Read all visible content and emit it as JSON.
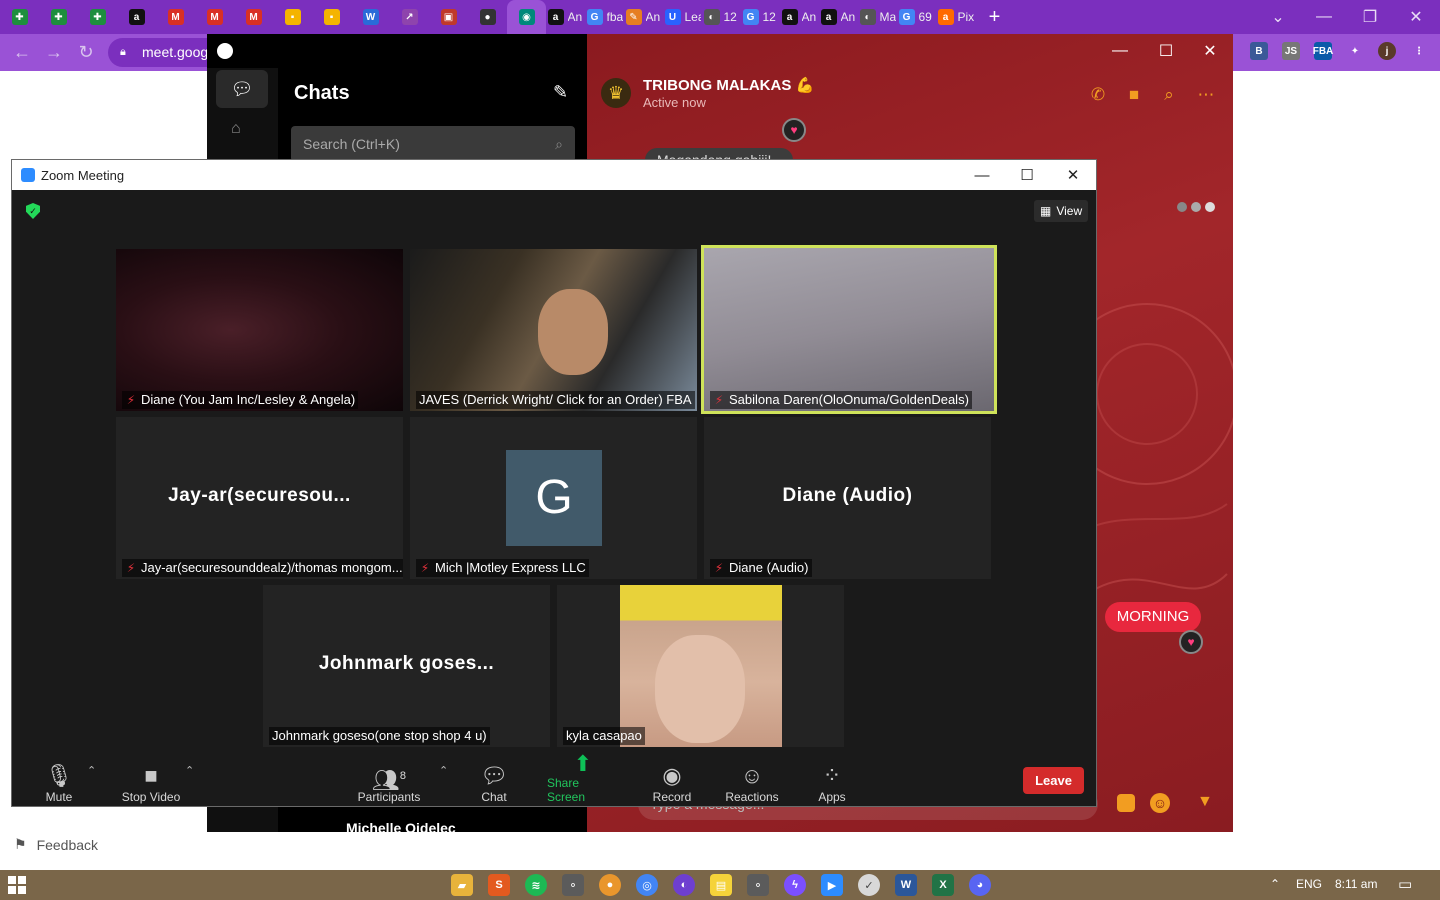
{
  "browser": {
    "tabs": [
      {
        "icon": "google-sheets-icon",
        "color": "#1e8e3e",
        "glyph": "✚",
        "label": ""
      },
      {
        "icon": "google-sheets-icon",
        "color": "#1e8e3e",
        "glyph": "✚",
        "label": ""
      },
      {
        "icon": "google-sheets-icon",
        "color": "#1e8e3e",
        "glyph": "✚",
        "label": ""
      },
      {
        "icon": "amazon-icon",
        "color": "#111111",
        "glyph": "a",
        "label": ""
      },
      {
        "icon": "gmail-icon",
        "color": "#d93025",
        "glyph": "M",
        "label": ""
      },
      {
        "icon": "gmail-icon",
        "color": "#d93025",
        "glyph": "M",
        "label": ""
      },
      {
        "icon": "gmail-icon",
        "color": "#d93025",
        "glyph": "M",
        "label": ""
      },
      {
        "icon": "keep-icon",
        "color": "#f4b400",
        "glyph": "▪",
        "label": ""
      },
      {
        "icon": "keep-icon",
        "color": "#f4b400",
        "glyph": "▪",
        "label": ""
      },
      {
        "icon": "w-icon",
        "color": "#2a6bd9",
        "glyph": "W",
        "label": ""
      },
      {
        "icon": "chart-icon",
        "color": "#8e44ad",
        "glyph": "↗",
        "label": ""
      },
      {
        "icon": "app-icon",
        "color": "#c0392b",
        "glyph": "▣",
        "label": ""
      },
      {
        "icon": "app-icon",
        "color": "#333333",
        "glyph": "●",
        "label": ""
      },
      {
        "icon": "meet-icon",
        "color": "#00897b",
        "glyph": "◉",
        "label": ""
      },
      {
        "icon": "amazon-icon",
        "color": "#111111",
        "glyph": "a",
        "label": "An"
      },
      {
        "icon": "google-icon",
        "color": "#4285f4",
        "glyph": "G",
        "label": "fba"
      },
      {
        "icon": "scout-icon",
        "color": "#e67e22",
        "glyph": "✎",
        "label": "An"
      },
      {
        "icon": "u-icon",
        "color": "#2962ff",
        "glyph": "U",
        "label": "Lea"
      },
      {
        "icon": "globe-icon",
        "color": "#555555",
        "glyph": "◐",
        "label": "12"
      },
      {
        "icon": "google-icon",
        "color": "#4285f4",
        "glyph": "G",
        "label": "12"
      },
      {
        "icon": "amazon-icon",
        "color": "#111111",
        "glyph": "a",
        "label": "An"
      },
      {
        "icon": "amazon-icon",
        "color": "#111111",
        "glyph": "a",
        "label": "An"
      },
      {
        "icon": "globe-icon",
        "color": "#555555",
        "glyph": "◐",
        "label": "Ma"
      },
      {
        "icon": "google-icon",
        "color": "#4285f4",
        "glyph": "G",
        "label": "69"
      },
      {
        "icon": "alibaba-icon",
        "color": "#ff6a00",
        "glyph": "a",
        "label": "Pix"
      }
    ],
    "new_tab": "+",
    "address": "meet.goog",
    "extensions": [
      "B",
      "JS",
      "FBA",
      "✦",
      "j",
      "⋮"
    ]
  },
  "feedback": {
    "label": "Feedback"
  },
  "messenger": {
    "chats_title": "Chats",
    "search_placeholder": "Search (Ctrl+K)",
    "chat_name": "TRIBONG MALAKAS 💪",
    "chat_status": "Active now",
    "partial_bubble": "Magandang gabiii!",
    "morning_message": "MORNING",
    "input_placeholder": "Type a message...",
    "bottom_contact": "Michelle Oidelec",
    "accent": "#f29d21"
  },
  "zoom": {
    "title": "Zoom Meeting",
    "view_label": "View",
    "participants": [
      {
        "label": "Diane (You Jam Inc/Lesley & Angela)",
        "muted": true,
        "type": "video-dark"
      },
      {
        "label": "JAVES (Derrick Wright/ Click for an Order) FBA",
        "muted": false,
        "type": "video-person"
      },
      {
        "label": "Sabilona Daren(OloOnuma/GoldenDeals)",
        "muted": true,
        "type": "video-grey",
        "speaking": true
      },
      {
        "label": "Jay-ar(securesounddealz)/thomas mongom...",
        "muted": true,
        "type": "name",
        "display": "Jay-ar(securesou..."
      },
      {
        "label": "Mich |Motley Express LLC",
        "muted": true,
        "type": "avatar",
        "initial": "G"
      },
      {
        "label": "Diane (Audio)",
        "muted": true,
        "type": "name",
        "display": "Diane (Audio)"
      },
      {
        "label": "Johnmark goseso(one stop shop 4 u)",
        "muted": false,
        "type": "name",
        "display": "Johnmark  goses..."
      },
      {
        "label": "kyla casapao",
        "muted": false,
        "type": "video-face"
      }
    ],
    "toolbar": {
      "mute": "Mute",
      "stop_video": "Stop Video",
      "participants": "Participants",
      "participant_count": "8",
      "chat": "Chat",
      "share_screen": "Share Screen",
      "record": "Record",
      "reactions": "Reactions",
      "apps": "Apps",
      "leave": "Leave"
    }
  },
  "taskbar": {
    "language": "ENG",
    "time": "8:11 am"
  }
}
